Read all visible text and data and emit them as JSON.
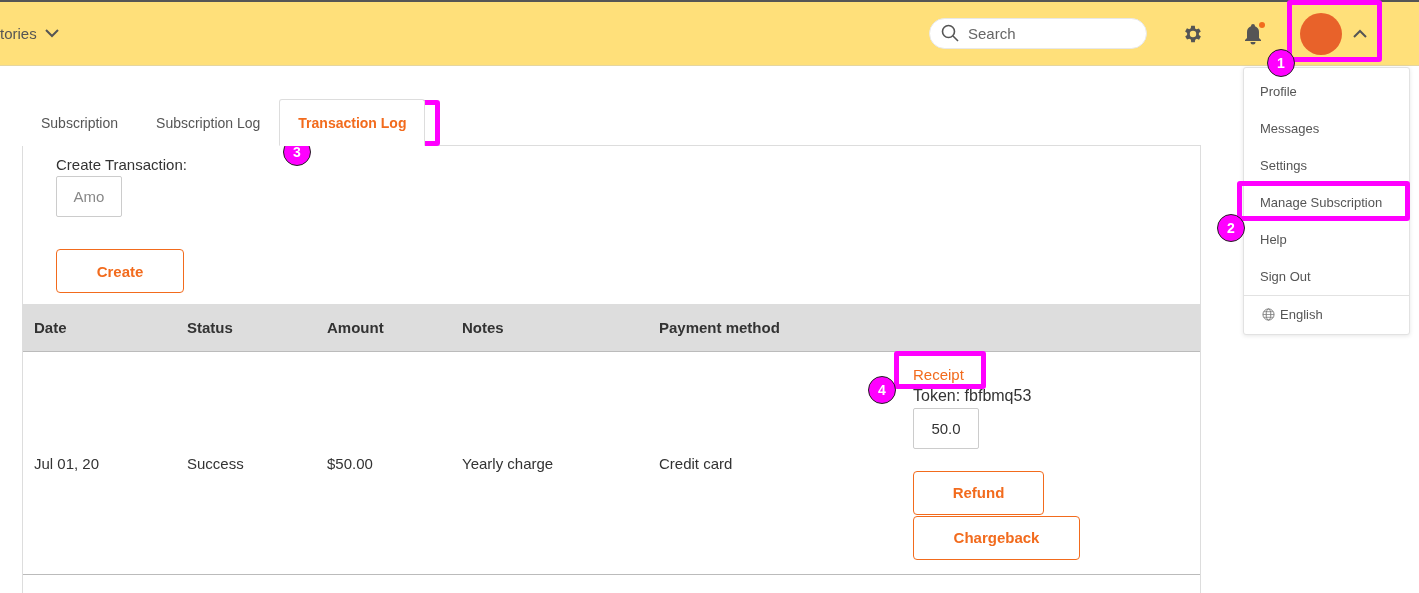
{
  "header": {
    "nav_label": "tories",
    "search": {
      "placeholder": "Search"
    },
    "notification_dot": true,
    "user_menu_open": true
  },
  "user_menu": {
    "items": [
      {
        "label": "Profile",
        "selected": false
      },
      {
        "label": "Messages",
        "selected": false
      },
      {
        "label": "Settings",
        "selected": false
      },
      {
        "label": "Manage Subscription",
        "selected": false
      },
      {
        "label": "Help",
        "selected": false
      },
      {
        "label": "Sign Out",
        "selected": false
      }
    ],
    "language": "English"
  },
  "tabs": [
    {
      "label": "Subscription",
      "selected": false
    },
    {
      "label": "Subscription Log",
      "selected": false
    },
    {
      "label": "Transaction Log",
      "selected": true
    }
  ],
  "create_transaction": {
    "label": "Create Transaction:",
    "amount": {
      "placeholder": "Amo"
    },
    "button": "Create"
  },
  "table": {
    "columns": [
      "Date",
      "Status",
      "Amount",
      "Notes",
      "Payment method"
    ],
    "rows": [
      {
        "cells": [
          "Jul 01, 20",
          "Success",
          "$50.00",
          "Yearly charge",
          "Credit card"
        ],
        "receipt": "Receipt",
        "token": "Token: fbfbmq53",
        "refund_amount": "50.0",
        "buttons": [
          "Refund",
          "Chargeback"
        ]
      }
    ]
  },
  "annotations": [
    {
      "number": "1"
    },
    {
      "number": "2"
    },
    {
      "number": "3"
    },
    {
      "number": "4"
    }
  ]
}
